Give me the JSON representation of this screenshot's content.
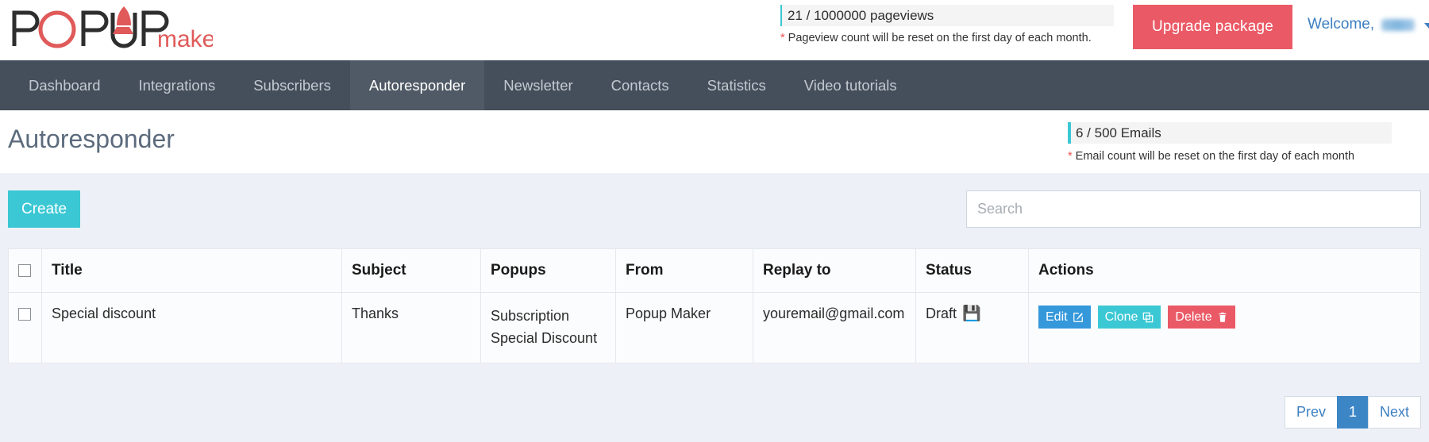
{
  "brand": {
    "logo_main": "POPUP",
    "logo_sub": "maker"
  },
  "topbar": {
    "pageviews_text": "21 / 1000000 pageviews",
    "pageviews_note_star": "*",
    "pageviews_note": " Pageview count will be reset on the first day of each month.",
    "upgrade_label": "Upgrade package",
    "welcome_label": "Welcome,"
  },
  "nav": {
    "items": [
      {
        "label": "Dashboard",
        "active": false
      },
      {
        "label": "Integrations",
        "active": false
      },
      {
        "label": "Subscribers",
        "active": false
      },
      {
        "label": "Autoresponder",
        "active": true
      },
      {
        "label": "Newsletter",
        "active": false
      },
      {
        "label": "Contacts",
        "active": false
      },
      {
        "label": "Statistics",
        "active": false
      },
      {
        "label": "Video tutorials",
        "active": false
      }
    ]
  },
  "page": {
    "title": "Autoresponder",
    "emails_text": "6 / 500 Emails",
    "emails_note_star": "*",
    "emails_note": " Email count will be reset on the first day of each month"
  },
  "toolbar": {
    "create_label": "Create",
    "search_placeholder": "Search",
    "search_value": ""
  },
  "table": {
    "headers": {
      "title": "Title",
      "subject": "Subject",
      "popups": "Popups",
      "from": "From",
      "replay_to": "Replay to",
      "status": "Status",
      "actions": "Actions"
    },
    "rows": [
      {
        "title": "Special discount",
        "subject": "Thanks",
        "popups_line1": "Subscription",
        "popups_line2": "Special Discount",
        "from": "Popup Maker",
        "replay_to": "youremail@gmail.com",
        "status": "Draft",
        "actions": {
          "edit": "Edit",
          "clone": "Clone",
          "delete": "Delete"
        }
      }
    ]
  },
  "pagination": {
    "prev": "Prev",
    "page_1": "1",
    "next": "Next"
  },
  "colors": {
    "accent_teal": "#3bc8d4",
    "accent_red": "#ea5a66",
    "accent_blue": "#3498db",
    "nav_bg": "#454f5b",
    "content_bg": "#edf1f7"
  }
}
